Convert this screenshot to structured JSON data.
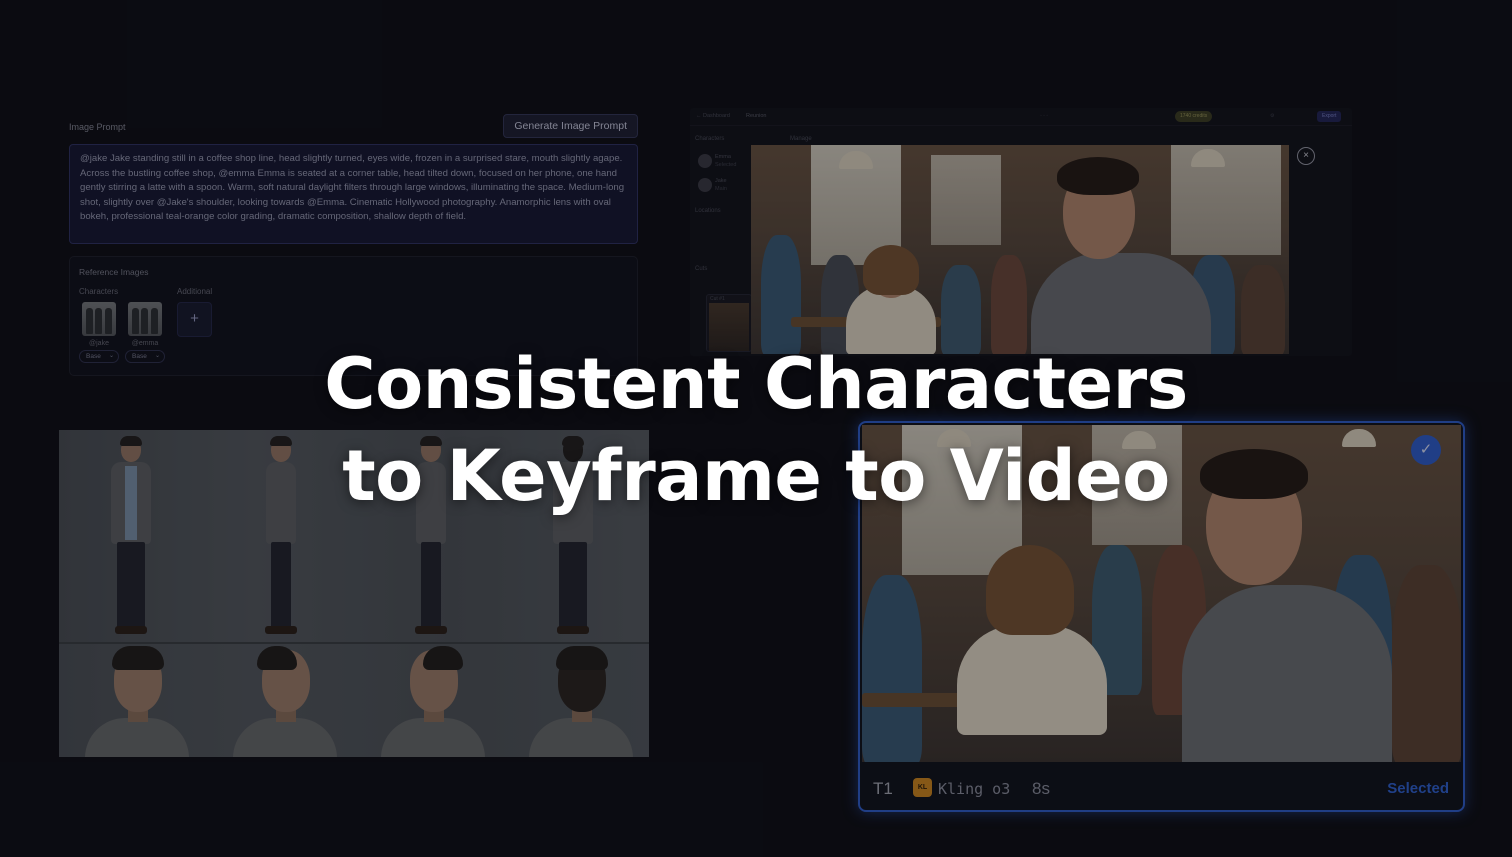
{
  "prompt_panel": {
    "label": "Image Prompt",
    "generate_button": "Generate Image Prompt",
    "prompt_text": "@jake Jake standing still in a coffee shop line, head slightly turned, eyes wide, frozen in a surprised stare, mouth slightly agape. Across the bustling coffee shop, @emma Emma is seated at a corner table, head tilted down, focused on her phone, one hand gently stirring a latte with a spoon. Warm, soft natural daylight filters through large windows, illuminating the space. Medium-long shot, slightly over @Jake's shoulder, looking towards @Emma. Cinematic Hollywood photography. Anamorphic lens with oval bokeh, professional teal-orange color grading, dramatic composition, shallow depth of field.",
    "reference_images": {
      "title": "Reference Images",
      "characters_label": "Characters",
      "additional_label": "Additional",
      "add_icon": "+",
      "characters": [
        {
          "handle": "@jake",
          "variant": "Base"
        },
        {
          "handle": "@emma",
          "variant": "Base"
        }
      ]
    }
  },
  "editor": {
    "breadcrumb_back": "← Dashboard",
    "breadcrumb_current": "Reunion",
    "credits_pill": "1740 credits",
    "export_button": "Export",
    "characters_label": "Characters",
    "manage_label": "Manage",
    "characters": [
      {
        "name": "Emma",
        "sub": "Selected"
      },
      {
        "name": "Jake",
        "sub": "Main"
      }
    ],
    "locations_label": "Locations",
    "cuts_label": "Cuts",
    "cut_item": "Cut #1",
    "close_icon": "×"
  },
  "video_card": {
    "track": "T1",
    "model_badge": "KL",
    "model": "Kling o3",
    "duration": "8s",
    "status": "Selected",
    "check_icon": "✓",
    "accent": "#2f5fd0"
  },
  "headline": {
    "line1": "Consistent Characters",
    "line2": "to Keyframe to Video"
  }
}
